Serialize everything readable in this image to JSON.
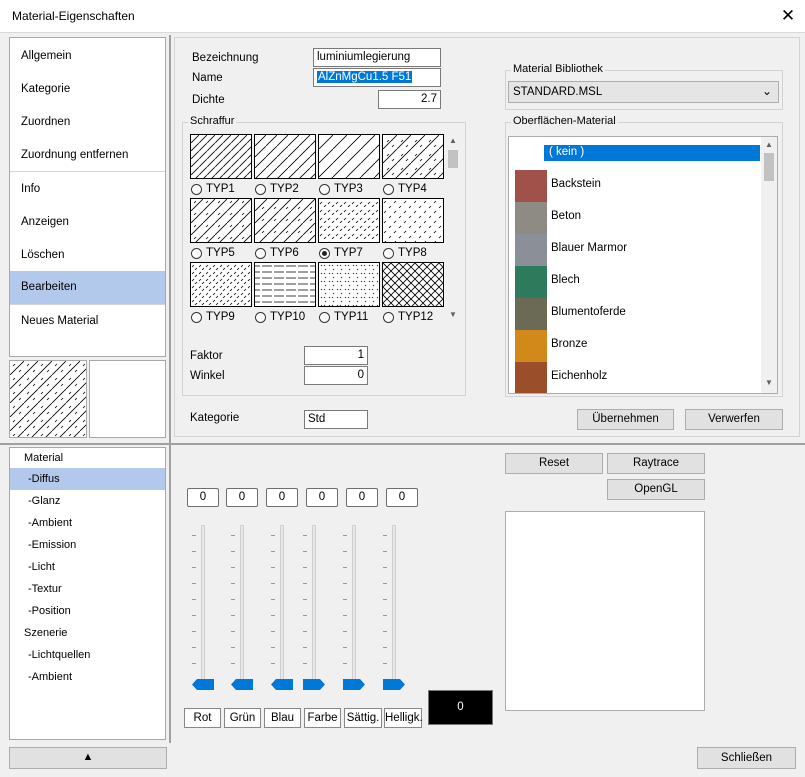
{
  "window": {
    "title": "Material-Eigenschaften"
  },
  "nav": {
    "items": [
      "Allgemein",
      "Kategorie",
      "Zuordnen",
      "Zuordnung entfernen",
      "Info",
      "Anzeigen",
      "Löschen",
      "Bearbeiten",
      "Neues Material"
    ],
    "selected": "Bearbeiten"
  },
  "form": {
    "bezeichnung_label": "Bezeichnung",
    "bezeichnung_value": "luminiumlegierung",
    "name_label": "Name",
    "name_value": "AlZnMgCu1.5 F51",
    "dichte_label": "Dichte",
    "dichte_value": "2.7"
  },
  "schraffur": {
    "group_label": "Schraffur",
    "types": [
      "TYP1",
      "TYP2",
      "TYP3",
      "TYP4",
      "TYP5",
      "TYP6",
      "TYP7",
      "TYP8",
      "TYP9",
      "TYP10",
      "TYP11",
      "TYP12"
    ],
    "selected": "TYP7",
    "faktor_label": "Faktor",
    "faktor_value": "1",
    "winkel_label": "Winkel",
    "winkel_value": "0"
  },
  "kategorie": {
    "label": "Kategorie",
    "value": "Std"
  },
  "bibliothek": {
    "group_label": "Material Bibliothek",
    "selected": "STANDARD.MSL"
  },
  "oberflaechen": {
    "group_label": "Oberflächen-Material",
    "items": [
      {
        "name": "( kein )",
        "color": "#0078d7"
      },
      {
        "name": "Backstein",
        "color": "#a0524a"
      },
      {
        "name": "Beton",
        "color": "#8e8a84"
      },
      {
        "name": "Blauer Marmor",
        "color": "#8a8f98"
      },
      {
        "name": "Blech",
        "color": "#2e7a5c"
      },
      {
        "name": "Blumentoferde",
        "color": "#6b6a55"
      },
      {
        "name": "Bronze",
        "color": "#d18a1a"
      },
      {
        "name": "Eichenholz",
        "color": "#9a4e2a"
      }
    ],
    "selected": "( kein )"
  },
  "buttons": {
    "uebernehmen": "Übernehmen",
    "verwerfen": "Verwerfen",
    "reset": "Reset",
    "raytrace": "Raytrace",
    "opengl": "OpenGL",
    "schliessen": "Schließen"
  },
  "tree": {
    "items": [
      {
        "label": "Material",
        "indent": 0
      },
      {
        "label": "-Diffus",
        "indent": 1
      },
      {
        "label": "-Glanz",
        "indent": 1
      },
      {
        "label": "-Ambient",
        "indent": 1
      },
      {
        "label": "-Emission",
        "indent": 1
      },
      {
        "label": "-Licht",
        "indent": 1
      },
      {
        "label": "-Textur",
        "indent": 1
      },
      {
        "label": "-Position",
        "indent": 1
      },
      {
        "label": "Szenerie",
        "indent": 0
      },
      {
        "label": "-Lichtquellen",
        "indent": 1
      },
      {
        "label": "-Ambient",
        "indent": 1
      }
    ],
    "selected": "-Diffus"
  },
  "color_controls": {
    "values": [
      "0",
      "0",
      "0",
      "0",
      "0",
      "0"
    ],
    "labels": [
      "Rot",
      "Grün",
      "Blau",
      "Farbe",
      "Sättig.",
      "Helligk."
    ],
    "swatch_value": "0",
    "swatch_color": "#000000",
    "accent": "#0078d7"
  }
}
